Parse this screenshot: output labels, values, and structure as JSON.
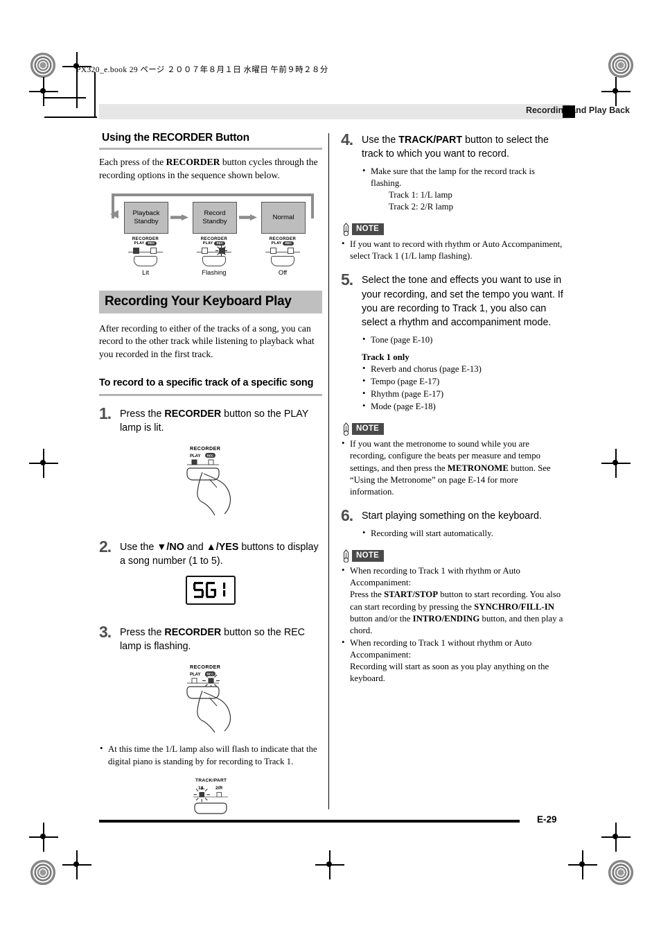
{
  "page": {
    "book_info": "PX320_e.book   29 ページ   ２００７年８月１日   水曜日   午前９時２８分",
    "running_head": "Recording and Play Back",
    "page_number": "E-29"
  },
  "left_column": {
    "section_title": "Using the RECORDER Button",
    "section_intro": "Each press of the RECORDER button cycles through the recording options in the sequence shown below.",
    "flow": {
      "boxes": [
        {
          "line1": "Playback",
          "line2": "Standby",
          "lamp_state": "Lit"
        },
        {
          "line1": "Record",
          "line2": "Standby",
          "lamp_state": "Flashing"
        },
        {
          "line1": "Normal",
          "line2": "",
          "lamp_state": "Off"
        }
      ],
      "lamp_labels": {
        "recorder": "RECORDER",
        "play": "PLAY",
        "rec": "REC"
      }
    },
    "main_heading": "Recording Your Keyboard Play",
    "main_intro": "After recording to either of the tracks of a song, you can record to the other track while listening to playback what you recorded in the first track.",
    "procedure_heading": "To record to a specific track of a specific song",
    "steps": [
      {
        "number": "1.",
        "text_parts": [
          "Press the ",
          "RECORDER",
          " button so the PLAY lamp is lit."
        ],
        "illustration": "hand-pressing-recorder-button"
      },
      {
        "number": "2.",
        "text_parts": [
          "Use the ",
          "▼/NO",
          " and ",
          "▲/YES",
          " buttons to display a song number (1 to 5)."
        ],
        "lcd_value": "SG1"
      },
      {
        "number": "3.",
        "text_parts": [
          "Press the ",
          "RECORDER",
          " button so the REC lamp is flashing."
        ],
        "illustration": "hand-pressing-recorder-button-flashing",
        "bullets": [
          "At this time the 1/L lamp also will flash to indicate that the digital piano is standing by for recording to Track 1."
        ],
        "track_part": {
          "title": "TRACK/PART",
          "left": "1/L",
          "right": "2/R"
        }
      }
    ]
  },
  "right_column": {
    "steps": [
      {
        "number": "4.",
        "text_parts": [
          "Use the ",
          "TRACK/PART",
          " button to select the track to which you want to record."
        ],
        "bullets": [
          "Make sure that the lamp for the record track is flashing."
        ],
        "sub_lines": [
          "Track 1: 1/L lamp",
          "Track 2: 2/R lamp"
        ]
      },
      {
        "number": "5.",
        "text": "Select the tone and effects you want to use in your recording, and set the tempo you want. If you are recording to Track 1, you also can select a rhythm and accompaniment mode.",
        "bullets": [
          "Tone (page E-10)"
        ],
        "track1_only_label": "Track 1 only",
        "track1_only_bullets": [
          "Reverb and chorus (page E-13)",
          "Tempo (page E-17)",
          "Rhythm (page E-17)",
          "Mode (page E-18)"
        ]
      },
      {
        "number": "6.",
        "text": "Start playing something on the keyboard.",
        "bullets": [
          "Recording will start automatically."
        ]
      }
    ],
    "notes": [
      {
        "label": "NOTE",
        "bullets": [
          "If you want to record with rhythm or Auto Accompaniment, select Track 1 (1/L lamp flashing)."
        ]
      },
      {
        "label": "NOTE",
        "bullets": [
          "If you want the metronome to sound while you are recording, configure the beats per measure and tempo settings, and then press the METRONOME button. See “Using the Metronome” on page E-14 for more information."
        ]
      },
      {
        "label": "NOTE",
        "bullets": [
          "When recording to Track 1 with rhythm or Auto Accompaniment: Press the START/STOP button to start recording. You also can start recording by pressing the SYNCHRO/FILL-IN button and/or the INTRO/ENDING button, and then play a chord.",
          "When recording to Track 1 without rhythm or Auto Accompaniment: Recording will start as soon as you play anything on the keyboard."
        ]
      }
    ]
  },
  "colors": {
    "heading_bar": "#bfbfbf",
    "running_head_band": "#e6e6e6",
    "note_label_bg": "#4a4a4a",
    "flow_box": "#bdbdbd",
    "step_number": "#4d4d4d"
  }
}
